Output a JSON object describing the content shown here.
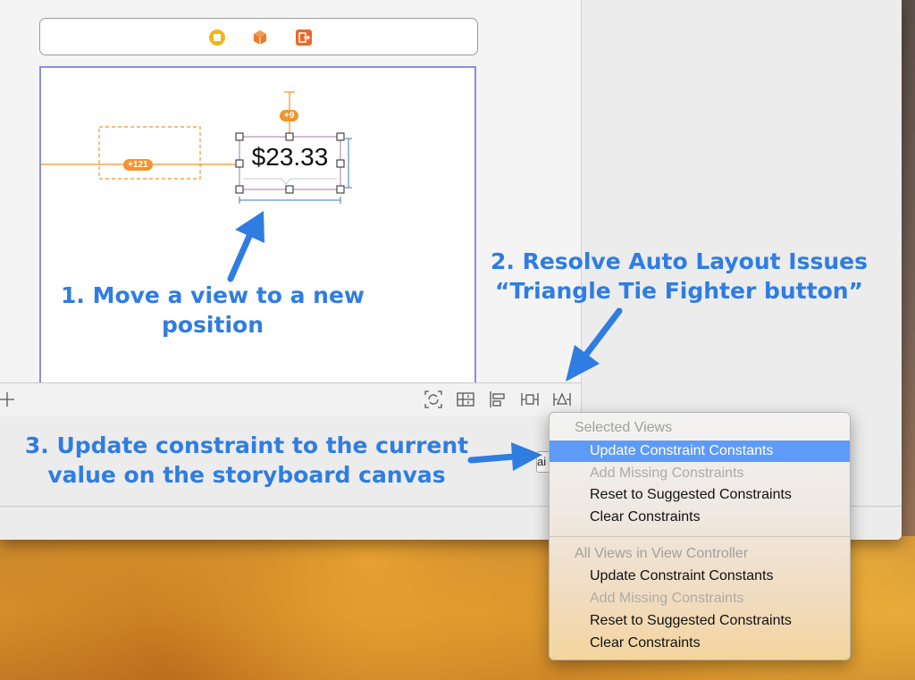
{
  "canvas": {
    "price_label": "$23.33",
    "constraint_badges": [
      "+9",
      "+121"
    ]
  },
  "annotations": {
    "step1_line1": "1. Move a view to a new",
    "step1_line2": "position",
    "step2_line1": "2. Resolve Auto Layout Issues",
    "step2_line2": "“Triangle Tie Fighter button”",
    "step3_line1": "3. Update constraint to the current",
    "step3_line2": "value on the storyboard canvas",
    "arrow_color": "#2f7de1"
  },
  "toolbar": {
    "icons": [
      "add-icon",
      "update-frames-icon",
      "embed-in-stack-icon",
      "align-icon",
      "add-constraints-icon",
      "resolve-auto-layout-issues-icon"
    ]
  },
  "scene_bar": {
    "icons": [
      "view-controller-icon",
      "first-responder-icon",
      "exit-icon"
    ]
  },
  "partial_button": {
    "label": "ai"
  },
  "resolve_menu": {
    "section1_header": "Selected Views",
    "section1_items": [
      {
        "label": "Update Constraint Constants",
        "state": "selected"
      },
      {
        "label": "Add Missing Constraints",
        "state": "disabled"
      },
      {
        "label": "Reset to Suggested Constraints",
        "state": "enabled"
      },
      {
        "label": "Clear Constraints",
        "state": "enabled"
      }
    ],
    "section2_header": "All Views in View Controller",
    "section2_items": [
      {
        "label": "Update Constraint Constants",
        "state": "enabled"
      },
      {
        "label": "Add Missing Constraints",
        "state": "disabled"
      },
      {
        "label": "Reset to Suggested Constraints",
        "state": "enabled"
      },
      {
        "label": "Clear Constraints",
        "state": "enabled"
      }
    ],
    "highlight_color": "#5e9bf6"
  }
}
